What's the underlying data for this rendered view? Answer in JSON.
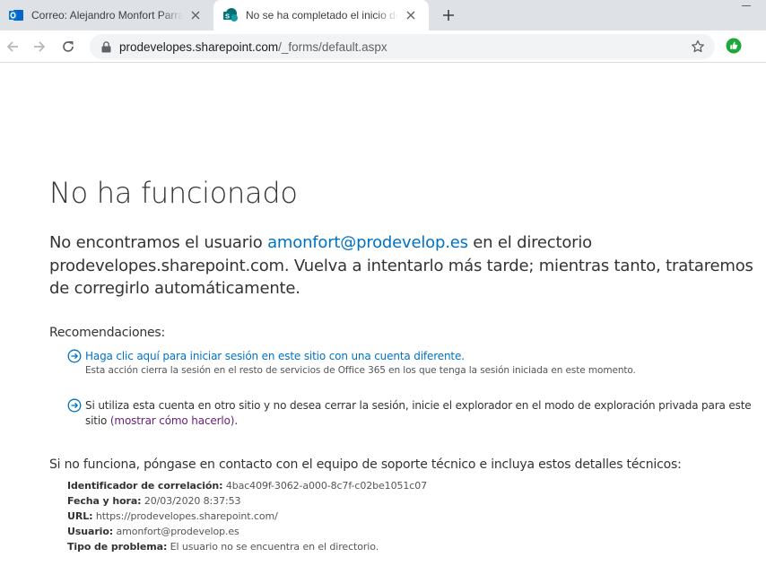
{
  "browser": {
    "tabs": [
      {
        "title": "Correo: Alejandro Monfort Parra",
        "favicon": "outlook-icon",
        "active": false
      },
      {
        "title": "No se ha completado el inicio de sesión",
        "favicon": "sharepoint-icon",
        "active": true
      }
    ],
    "address": {
      "host": "prodevelopes.sharepoint.com",
      "path": "/_forms/default.aspx"
    }
  },
  "page": {
    "title": "No ha funcionado",
    "message": {
      "part1": "No encontramos el usuario ",
      "user": "amonfort@prodevelop.es",
      "part2": " en el directorio prodevelopes.sharepoint.com. Vuelva a intentarlo más tarde; mientras tanto, trataremos de corregirlo automáticamente."
    },
    "recommendations_heading": "Recomendaciones:",
    "rec1": {
      "link": "Haga clic aquí para iniciar sesión en este sitio con una cuenta diferente.",
      "note": "Esta acción cierra la sesión en el resto de servicios de Office 365 en los que tenga la sesión iniciada en este momento."
    },
    "rec2": {
      "text": "Si utiliza esta cuenta en otro sitio y no desea cerrar la sesión, inicie el explorador en el modo de exploración privada para este sitio ",
      "link": "(mostrar cómo hacerlo)",
      "end": "."
    },
    "support_text": "Si no funciona, póngase en contacto con el equipo de soporte técnico e incluya estos detalles técnicos:",
    "details": [
      {
        "label": "Identificador de correlación:",
        "value": "4bac409f-3062-a000-8c7f-c02be1051c07"
      },
      {
        "label": "Fecha y hora:",
        "value": "20/03/2020 8:37:53"
      },
      {
        "label": "URL:",
        "value": "https://prodevelopes.sharepoint.com/"
      },
      {
        "label": "Usuario:",
        "value": "amonfort@prodevelop.es"
      },
      {
        "label": "Tipo de problema:",
        "value": "El usuario no se encuentra en el directorio."
      }
    ]
  },
  "colors": {
    "link": "#0072c6",
    "visited_link": "#68217a",
    "text": "#333333",
    "tabstrip": "#dee1e6"
  }
}
